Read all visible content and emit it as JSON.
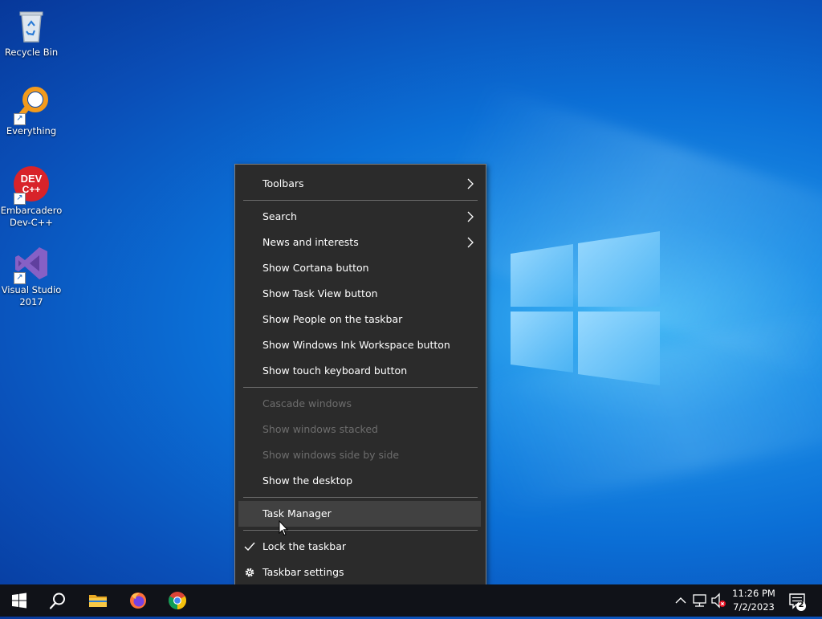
{
  "desktop": {
    "icons": [
      {
        "label": "Recycle Bin",
        "icon": "recycle-bin-icon"
      },
      {
        "label": "Everything",
        "icon": "everything-search-icon"
      },
      {
        "label": "Embarcadero Dev-C++",
        "icon": "devcpp-icon",
        "badge": "DEV C++"
      },
      {
        "label": "Visual Studio 2017",
        "icon": "visual-studio-icon"
      }
    ]
  },
  "context_menu": {
    "items": [
      {
        "label": "Toolbars",
        "submenu": true,
        "enabled": true
      },
      {
        "label": "Search",
        "submenu": true,
        "enabled": true
      },
      {
        "label": "News and interests",
        "submenu": true,
        "enabled": true
      },
      {
        "label": "Show Cortana button",
        "enabled": true
      },
      {
        "label": "Show Task View button",
        "enabled": true
      },
      {
        "label": "Show People on the taskbar",
        "enabled": true
      },
      {
        "label": "Show Windows Ink Workspace button",
        "enabled": true
      },
      {
        "label": "Show touch keyboard button",
        "enabled": true
      },
      {
        "label": "Cascade windows",
        "enabled": false
      },
      {
        "label": "Show windows stacked",
        "enabled": false
      },
      {
        "label": "Show windows side by side",
        "enabled": false
      },
      {
        "label": "Show the desktop",
        "enabled": true
      },
      {
        "label": "Task Manager",
        "enabled": true,
        "highlighted": true
      },
      {
        "label": "Lock the taskbar",
        "enabled": true,
        "checked": true,
        "icon": "checkmark-icon"
      },
      {
        "label": "Taskbar settings",
        "enabled": true,
        "icon": "gear-icon"
      }
    ]
  },
  "taskbar": {
    "pinned": [
      {
        "name": "start-button",
        "icon": "windows-logo-icon"
      },
      {
        "name": "search-button",
        "icon": "search-icon"
      },
      {
        "name": "file-explorer-button",
        "icon": "folder-icon"
      },
      {
        "name": "firefox-button",
        "icon": "firefox-icon"
      },
      {
        "name": "chrome-button",
        "icon": "chrome-icon"
      }
    ],
    "tray": {
      "icons": [
        "chevron-up-icon",
        "network-icon",
        "volume-muted-icon"
      ],
      "time": "11:26 PM",
      "date": "7/2/2023",
      "notification_count": "2"
    }
  },
  "colors": {
    "menu_bg": "#2b2b2b",
    "menu_highlight": "#414141",
    "menu_disabled_text": "#6d6d6d",
    "taskbar_bg": "#101218",
    "desktop_blue": "#0b6fd6"
  }
}
